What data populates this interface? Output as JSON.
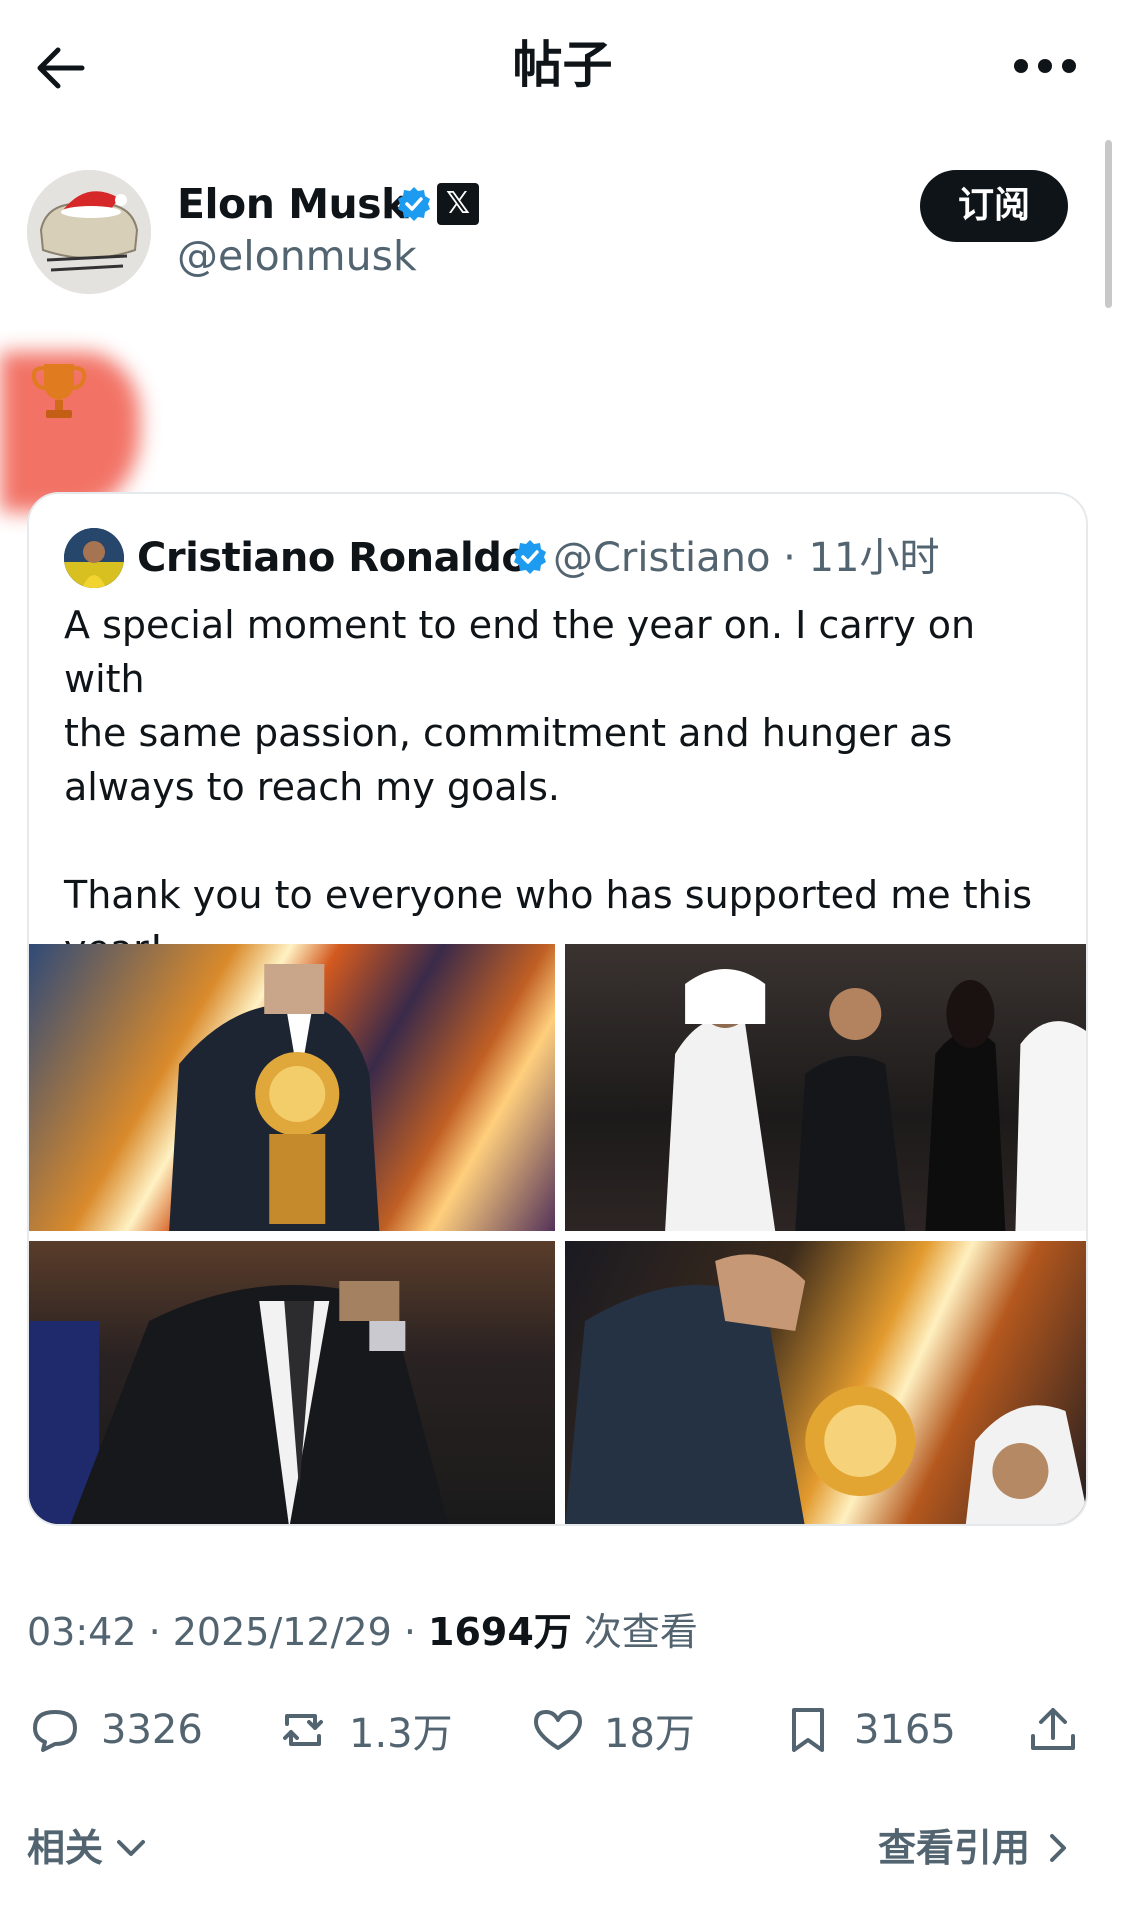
{
  "header": {
    "title": "帖子"
  },
  "author": {
    "name": "Elon Musk",
    "handle": "@elonmusk",
    "x_badge": "𝕏",
    "subscribe_label": "订阅"
  },
  "post": {
    "content_emoji": "🏆",
    "timestamp": "03:42 · 2025/12/29 · ",
    "views_count": "1694万",
    "views_label": " 次查看"
  },
  "quote": {
    "name": "Cristiano Ronaldo",
    "handle_time": "@Cristiano · 11小时",
    "text": "A special moment to end the year on. I carry on with\nthe same passion, commitment and hunger as\nalways to reach my goals.\n\nThank you to everyone who has supported me this\nyear!",
    "media_count": 4
  },
  "actions": {
    "replies": "3326",
    "reposts": "1.3万",
    "likes": "18万",
    "bookmarks": "3165"
  },
  "footer": {
    "related_label": "相关",
    "view_quotes_label": "查看引用"
  },
  "colors": {
    "text": "#0f1419",
    "secondary": "#536471",
    "verified": "#1d9bf0",
    "button_bg": "#0f1419"
  },
  "icons": [
    "back-arrow-icon",
    "more-icon",
    "verified-icon",
    "trophy-icon",
    "reply-icon",
    "repost-icon",
    "like-icon",
    "bookmark-icon",
    "share-icon",
    "chevron-down-icon",
    "chevron-right-icon"
  ]
}
